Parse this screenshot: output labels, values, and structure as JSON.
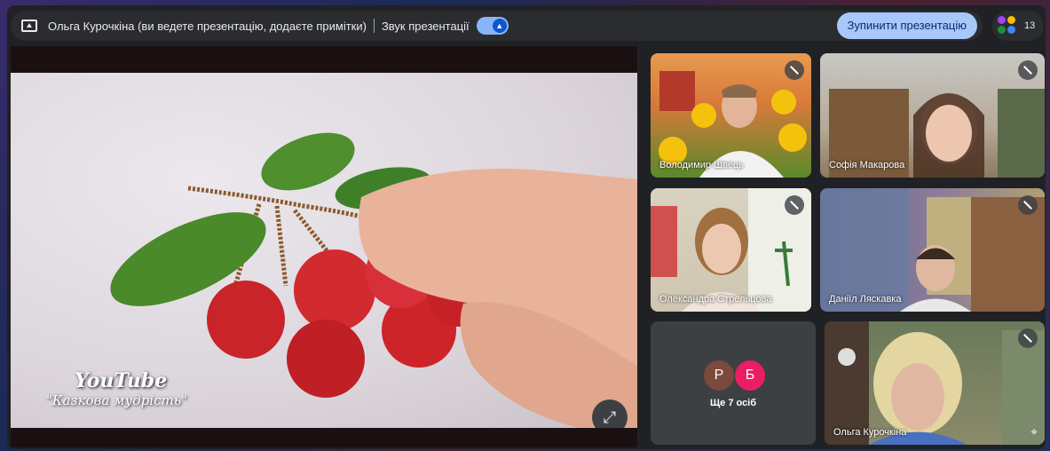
{
  "topbar": {
    "presenter_text": "Ольга Курочкіна (ви ведете презентацію, додаєте примітки)",
    "sound_label": "Звук презентації",
    "sound_on": true,
    "stop_button": "Зупинити презентацію"
  },
  "people": {
    "count": "13"
  },
  "presentation": {
    "watermark_logo": "YouTube",
    "watermark_caption": "\"Казкова мудрість\""
  },
  "participants": [
    {
      "name": "Володимир Швець",
      "muted": true
    },
    {
      "name": "Софія Макарова",
      "muted": true
    },
    {
      "name": "Олександра Стрельцова",
      "muted": true
    },
    {
      "name": "Даніїл Ляскавка",
      "muted": true
    },
    {
      "name": "Ольга Курочкіна",
      "muted": true
    }
  ],
  "others": {
    "avatars": [
      "Р",
      "Б"
    ],
    "label": "Ще 7 осіб"
  },
  "colors": {
    "accent": "#a8c7fa",
    "tile_bg": "#3c4043",
    "avatar_r": "#7b4a3a",
    "avatar_b": "#e91e63"
  }
}
